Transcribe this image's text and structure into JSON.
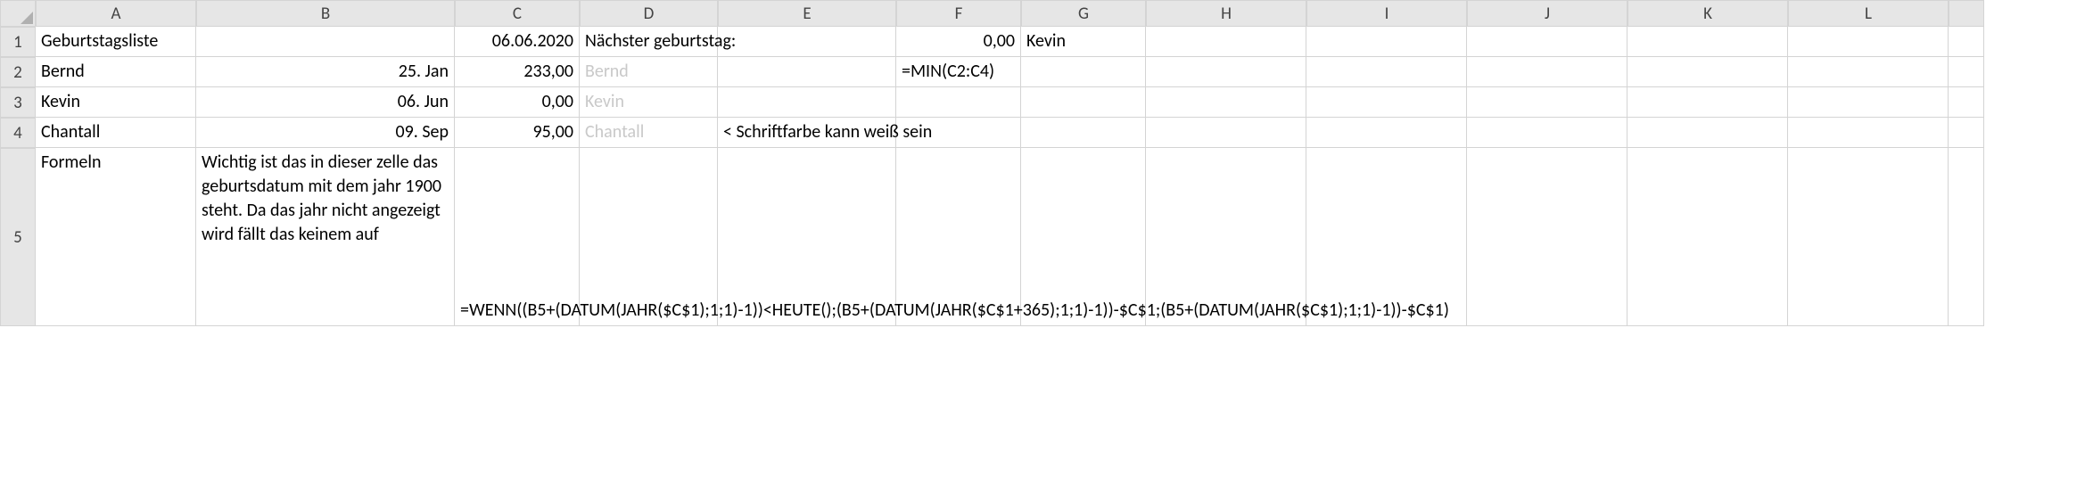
{
  "columns": [
    "A",
    "B",
    "C",
    "D",
    "E",
    "F",
    "G",
    "H",
    "I",
    "J",
    "K",
    "L",
    ""
  ],
  "rows": [
    "1",
    "2",
    "3",
    "4",
    "5"
  ],
  "cells": {
    "A1": "Geburtstagsliste",
    "C1": "06.06.2020",
    "D1": "Nächster geburtstag:",
    "F1": "0,00",
    "G1": "Kevin",
    "A2": "Bernd",
    "B2": "25. Jan",
    "C2": "233,00",
    "D2": "Bernd",
    "F2": "=MIN(C2:C4)",
    "A3": "Kevin",
    "B3": "06. Jun",
    "C3": "0,00",
    "D3": "Kevin",
    "A4": "Chantall",
    "B4": "09. Sep",
    "C4": "95,00",
    "D4": "Chantall",
    "E4": "< Schriftfarbe kann weiß sein",
    "A5": "Formeln",
    "B5": "Wichtig ist das in dieser zelle das geburtsdatum mit dem jahr 1900 steht. Da das jahr nicht angezeigt wird fällt das keinem auf",
    "C5": "=WENN((B5+(DATUM(JAHR($C$1);1;1)-1))<HEUTE();(B5+(DATUM(JAHR($C$1+365);1;1)-1))-$C$1;(B5+(DATUM(JAHR($C$1);1;1)-1))-$C$1)"
  }
}
